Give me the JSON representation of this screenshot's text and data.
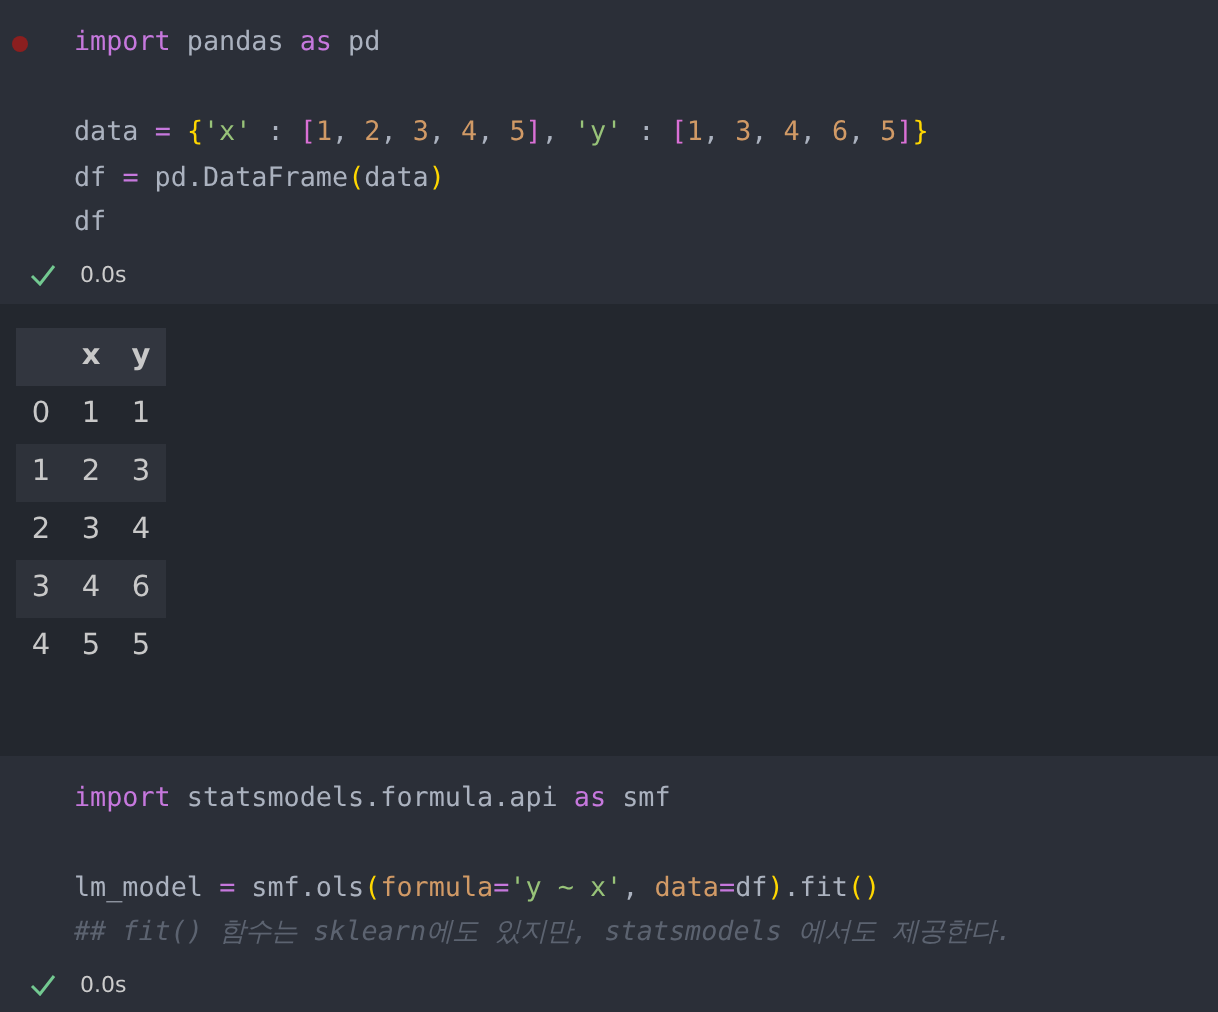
{
  "cells": [
    {
      "breakpoint": true,
      "lines": [
        {
          "kind": "code",
          "tokens": [
            {
              "text": "import",
              "kind": "keyword"
            },
            {
              "text": " pandas ",
              "kind": "plain"
            },
            {
              "text": "as",
              "kind": "keyword"
            },
            {
              "text": " pd",
              "kind": "plain"
            }
          ]
        },
        {
          "kind": "blank"
        },
        {
          "kind": "code",
          "tokens": [
            {
              "text": "data ",
              "kind": "plain"
            },
            {
              "text": "= ",
              "kind": "operator"
            },
            {
              "text": "{",
              "kind": "bracket1"
            },
            {
              "text": "'x'",
              "kind": "string"
            },
            {
              "text": " : ",
              "kind": "plain"
            },
            {
              "text": "[",
              "kind": "bracket2"
            },
            {
              "text": "1",
              "kind": "number"
            },
            {
              "text": ", ",
              "kind": "plain"
            },
            {
              "text": "2",
              "kind": "number"
            },
            {
              "text": ", ",
              "kind": "plain"
            },
            {
              "text": "3",
              "kind": "number"
            },
            {
              "text": ", ",
              "kind": "plain"
            },
            {
              "text": "4",
              "kind": "number"
            },
            {
              "text": ", ",
              "kind": "plain"
            },
            {
              "text": "5",
              "kind": "number"
            },
            {
              "text": "]",
              "kind": "bracket2"
            },
            {
              "text": ", ",
              "kind": "plain"
            },
            {
              "text": "'y'",
              "kind": "string"
            },
            {
              "text": " : ",
              "kind": "plain"
            },
            {
              "text": "[",
              "kind": "bracket2"
            },
            {
              "text": "1",
              "kind": "number"
            },
            {
              "text": ", ",
              "kind": "plain"
            },
            {
              "text": "3",
              "kind": "number"
            },
            {
              "text": ", ",
              "kind": "plain"
            },
            {
              "text": "4",
              "kind": "number"
            },
            {
              "text": ", ",
              "kind": "plain"
            },
            {
              "text": "6",
              "kind": "number"
            },
            {
              "text": ", ",
              "kind": "plain"
            },
            {
              "text": "5",
              "kind": "number"
            },
            {
              "text": "]",
              "kind": "bracket2"
            },
            {
              "text": "}",
              "kind": "bracket1"
            }
          ]
        },
        {
          "kind": "code",
          "tokens": [
            {
              "text": "df ",
              "kind": "plain"
            },
            {
              "text": "=",
              "kind": "operator"
            },
            {
              "text": " pd.DataFrame",
              "kind": "plain"
            },
            {
              "text": "(",
              "kind": "bracket1"
            },
            {
              "text": "data",
              "kind": "plain"
            },
            {
              "text": ")",
              "kind": "bracket1"
            }
          ]
        },
        {
          "kind": "code",
          "tokens": [
            {
              "text": "df",
              "kind": "plain"
            }
          ]
        }
      ],
      "status": "0.0s",
      "output": {
        "columns": [
          "",
          "x",
          "y"
        ],
        "rows": [
          [
            "0",
            "1",
            "1"
          ],
          [
            "1",
            "2",
            "3"
          ],
          [
            "2",
            "3",
            "4"
          ],
          [
            "3",
            "4",
            "6"
          ],
          [
            "4",
            "5",
            "5"
          ]
        ]
      }
    },
    {
      "breakpoint": false,
      "lines": [
        {
          "kind": "code",
          "tokens": [
            {
              "text": "import",
              "kind": "keyword"
            },
            {
              "text": " statsmodels.formula.api ",
              "kind": "plain"
            },
            {
              "text": "as",
              "kind": "keyword"
            },
            {
              "text": " smf",
              "kind": "plain"
            }
          ]
        },
        {
          "kind": "blank"
        },
        {
          "kind": "code",
          "tokens": [
            {
              "text": "lm_model ",
              "kind": "plain"
            },
            {
              "text": "=",
              "kind": "operator"
            },
            {
              "text": " smf.ols",
              "kind": "plain"
            },
            {
              "text": "(",
              "kind": "bracket1"
            },
            {
              "text": "formula",
              "kind": "param"
            },
            {
              "text": "=",
              "kind": "operator"
            },
            {
              "text": "'y ~ x'",
              "kind": "string"
            },
            {
              "text": ", ",
              "kind": "plain"
            },
            {
              "text": "data",
              "kind": "param"
            },
            {
              "text": "=",
              "kind": "operator"
            },
            {
              "text": "df",
              "kind": "plain"
            },
            {
              "text": ")",
              "kind": "bracket1"
            },
            {
              "text": ".fit",
              "kind": "plain"
            },
            {
              "text": "()",
              "kind": "bracket1"
            }
          ]
        },
        {
          "kind": "code",
          "tokens": [
            {
              "text": "## fit() 함수는 sklearn에도 있지만, statsmodels 에서도 제공한다.",
              "kind": "comment"
            }
          ]
        }
      ],
      "status": "0.0s"
    }
  ]
}
